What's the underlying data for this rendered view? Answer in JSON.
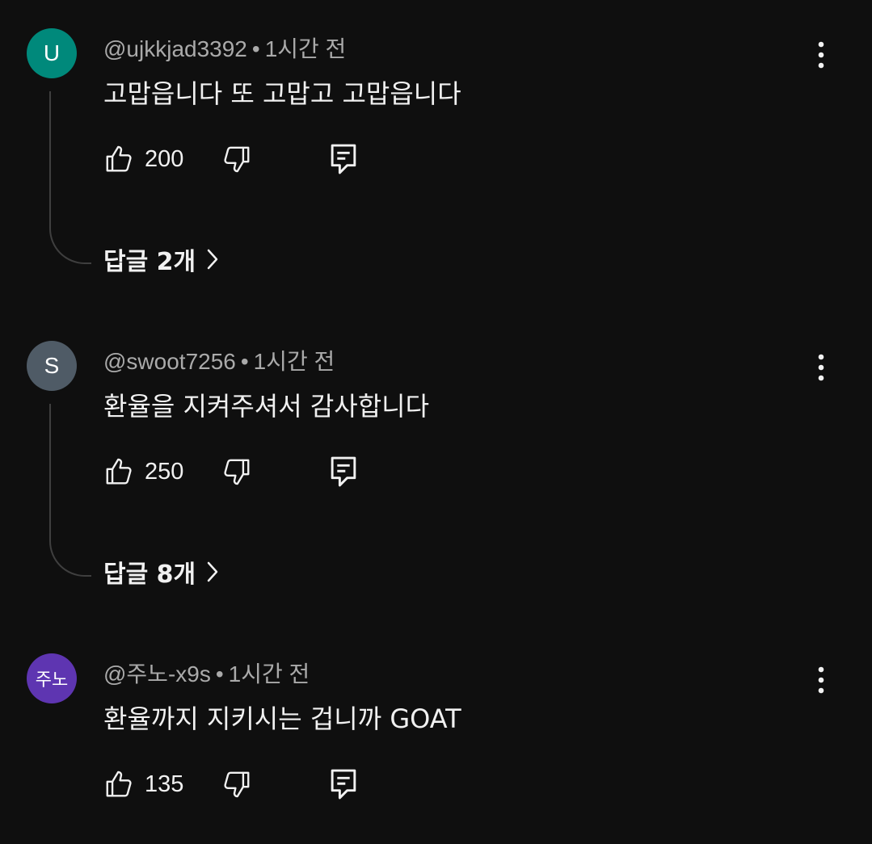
{
  "comments": [
    {
      "avatar_letter": "U",
      "avatar_color": "#00897b",
      "username": "@ujkkjad3392",
      "separator": "•",
      "time": "1시간 전",
      "text": "고맙읍니다 또 고맙고 고맙읍니다",
      "likes": "200",
      "replies_label": "답글 2개"
    },
    {
      "avatar_letter": "S",
      "avatar_color": "#4f5b66",
      "username": "@swoot7256",
      "separator": "•",
      "time": "1시간 전",
      "text": "환율을 지켜주셔서 감사합니다",
      "likes": "250",
      "replies_label": "답글 8개"
    },
    {
      "avatar_letter": "주노",
      "avatar_color": "#5e35b1",
      "username": "@주노-x9s",
      "separator": "•",
      "time": "1시간 전",
      "text": "환율까지 지키시는 겁니까 GOAT",
      "likes": "135"
    }
  ],
  "icons": {
    "like": "thumbs-up-icon",
    "dislike": "thumbs-down-icon",
    "reply": "reply-comment-icon",
    "more": "more-vertical-icon",
    "expand": "chevron-right-icon"
  },
  "colors": {
    "background": "#0f0f0f",
    "primary_text": "#f1f1f1",
    "secondary_text": "#aaaaaa",
    "thread_line": "#3f3f3f"
  }
}
